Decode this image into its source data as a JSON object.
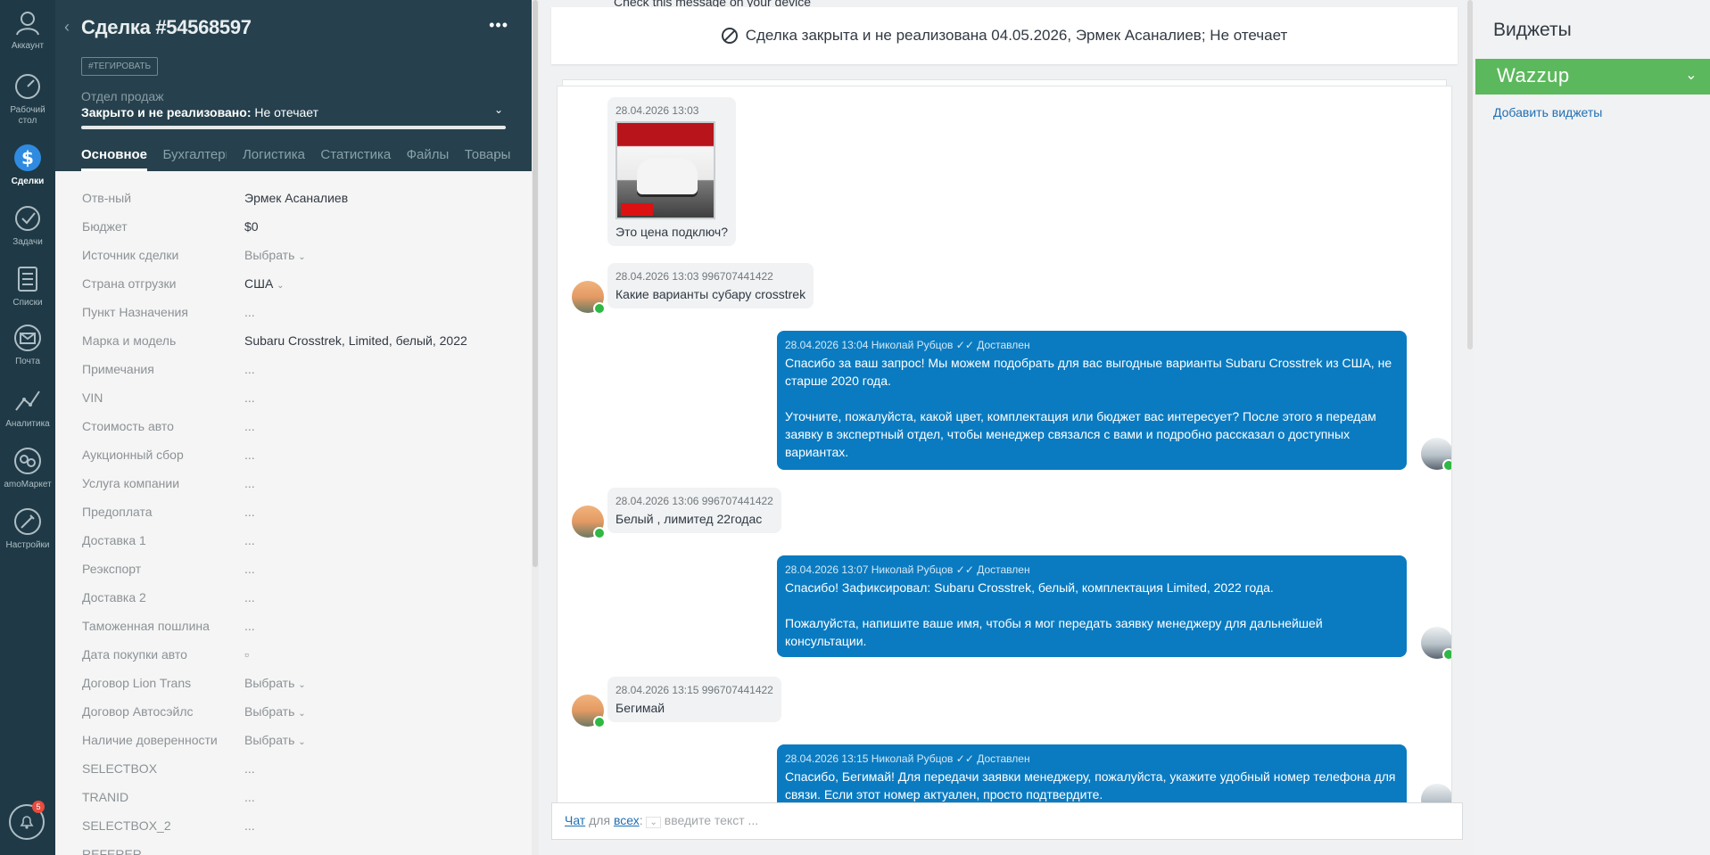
{
  "nav": {
    "items": [
      {
        "label": "Аккаунт",
        "icon": "account-icon"
      },
      {
        "label": "Рабочий стол",
        "icon": "dashboard-icon"
      },
      {
        "label": "Сделки",
        "icon": "deals-icon"
      },
      {
        "label": "Задачи",
        "icon": "tasks-icon"
      },
      {
        "label": "Списки",
        "icon": "lists-icon"
      },
      {
        "label": "Почта",
        "icon": "mail-icon"
      },
      {
        "label": "Аналитика",
        "icon": "analytics-icon"
      },
      {
        "label": "amoМаркет",
        "icon": "market-icon"
      },
      {
        "label": "Настройки",
        "icon": "settings-icon"
      }
    ],
    "notification_count": "5"
  },
  "deal": {
    "title": "Сделка #54568597",
    "tag_button": "#ТЕГИРОВАТЬ",
    "pipeline": "Отдел продаж",
    "status_bold": "Закрыто и не реализовано:",
    "status_reason": "Не отечает",
    "tabs": [
      "Основное",
      "Бухгалтерия",
      "Логистика",
      "Статистика",
      "Файлы",
      "Товары"
    ],
    "tabs_more": "···"
  },
  "fields": [
    {
      "label": "Отв-ный",
      "value": "Эрмек Асаналиев"
    },
    {
      "label": "Бюджет",
      "value": "$0"
    },
    {
      "label": "Источник сделки",
      "value": "Выбрать"
    },
    {
      "label": "Страна отгрузки",
      "value": "США"
    },
    {
      "label": "Пункт Назначения",
      "value": "..."
    },
    {
      "label": "Марка и модель",
      "value": "Subaru Crosstrek, Limited, белый, 2022"
    },
    {
      "label": "Примечания",
      "value": "..."
    },
    {
      "label": "VIN",
      "value": "..."
    },
    {
      "label": "Стоимость авто",
      "value": "..."
    },
    {
      "label": "Аукционный сбор",
      "value": "..."
    },
    {
      "label": "Услуга компании",
      "value": "..."
    },
    {
      "label": "Предоплата",
      "value": "..."
    },
    {
      "label": "Доставка 1",
      "value": "..."
    },
    {
      "label": "Реэкспорт",
      "value": "..."
    },
    {
      "label": "Доставка 2",
      "value": "..."
    },
    {
      "label": "Таможенная пошлина",
      "value": "..."
    },
    {
      "label": "Дата покупки авто",
      "value": "▫"
    },
    {
      "label": "Договор Lion Trans",
      "value": "Выбрать"
    },
    {
      "label": "Договор Автосэйлс",
      "value": "Выбрать"
    },
    {
      "label": "Наличие доверенности",
      "value": "Выбрать"
    },
    {
      "label": "SELECTBOX",
      "value": "..."
    },
    {
      "label": "TRANID",
      "value": "..."
    },
    {
      "label": "SELECTBOX_2",
      "value": "..."
    },
    {
      "label": "REFERER",
      "value": ""
    }
  ],
  "feed": {
    "top_message": "Check this message on your device",
    "closed_notice": "Сделка закрыта и не реализована 04.05.2026, Эрмек Асаналиев; Не отечает",
    "messages": [
      {
        "meta": "28.04.2026 13:03",
        "text": "Это цена подключ?"
      },
      {
        "meta": "28.04.2026 13:03 996707441422",
        "text": "Какие варианты субару crosstrek"
      },
      {
        "meta": "28.04.2026 13:04 Николай Рубцов  ✓✓ Доставлен",
        "text": "Спасибо за ваш запрос! Мы можем подобрать для вас выгодные варианты Subaru Crosstrek из США, не старше 2020 года.\n\nУточните, пожалуйста, какой цвет, комплектация или бюджет вас интересует? После этого я передам заявку в экспертный отдел, чтобы менеджер связался с вами и подробно рассказал о доступных вариантах."
      },
      {
        "meta": "28.04.2026 13:06 996707441422",
        "text": "Белый , лимитед 22годас"
      },
      {
        "meta": "28.04.2026 13:07 Николай Рубцов  ✓✓ Доставлен",
        "text": "Спасибо! Зафиксировал: Subaru Crosstrek, белый, комплектация Limited, 2022 года.\n\nПожалуйста, напишите ваше имя, чтобы я мог передать заявку менеджеру для дальнейшей консультации."
      },
      {
        "meta": "28.04.2026 13:15 996707441422",
        "text": "Бегимай"
      },
      {
        "meta": "28.04.2026 13:15 Николай Рубцов  ✓✓ Доставлен",
        "text": "Спасибо, Бегимай! Для передачи заявки менеджеру, пожалуйста, укажите удобный номер телефона для связи. Если этот номер актуален, просто подтвердите."
      }
    ],
    "input": {
      "chat_link": "Чат",
      "for": "для",
      "all_link": "всех",
      "colon": ":",
      "placeholder": "введите текст ..."
    }
  },
  "widgets": {
    "title": "Виджеты",
    "wazzup": "Wazzup",
    "add_link": "Добавить виджеты"
  },
  "colors": {
    "nav_bg": "#1f3a46",
    "header_bg": "#26414d",
    "outgoing_bubble": "#0a7bc1",
    "wazzup_green": "#5cb85c",
    "whatsapp_green": "#2fb844"
  }
}
